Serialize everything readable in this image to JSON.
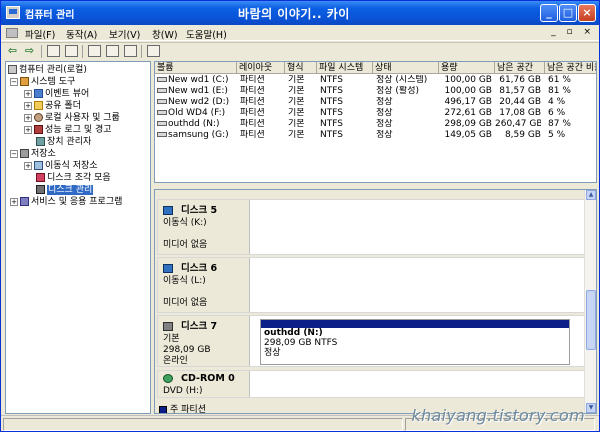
{
  "window": {
    "title": "컴퓨터 관리",
    "overlay_title": "바람의 이야기.. 카이",
    "controls": {
      "minimize": "_",
      "maximize": "□",
      "close": "×"
    }
  },
  "menu": {
    "items": [
      "파일(F)",
      "동작(A)",
      "보기(V)",
      "창(W)",
      "도움말(H)"
    ],
    "mdi_controls": "_ ▫ ×"
  },
  "toolbar": {
    "back": "⇦",
    "forward": "⇨"
  },
  "tree": {
    "root": "컴퓨터 관리(로컬)",
    "system_tools": "시스템 도구",
    "event_viewer": "이벤트 뷰어",
    "shared_folders": "공유 폴더",
    "local_users": "로컬 사용자 및 그룹",
    "perf_logs": "성능 로그 및 경고",
    "device_manager": "장치 관리자",
    "storage": "저장소",
    "removable_storage": "이동식 저장소",
    "defrag": "디스크 조각 모음",
    "disk_management": "디스크 관리",
    "services": "서비스 및 응용 프로그램"
  },
  "volumes": {
    "columns": [
      "볼륨",
      "레이아웃",
      "형식",
      "파일 시스템",
      "상태",
      "용량",
      "남은 공간",
      "남은 공간 비율"
    ],
    "rows": [
      [
        "New wd1 (C:)",
        "파티션",
        "기본",
        "NTFS",
        "정상 (시스템)",
        "100,00 GB",
        "61,76 GB",
        "61 %"
      ],
      [
        "New wd1 (E:)",
        "파티션",
        "기본",
        "NTFS",
        "정상 (활성)",
        "100,00 GB",
        "81,57 GB",
        "81 %"
      ],
      [
        "New wd2 (D:)",
        "파티션",
        "기본",
        "NTFS",
        "정상",
        "496,17 GB",
        "20,44 GB",
        "4 %"
      ],
      [
        "Old WD4 (F:)",
        "파티션",
        "기본",
        "NTFS",
        "정상",
        "272,61 GB",
        "17,08 GB",
        "6 %"
      ],
      [
        "outhdd (N:)",
        "파티션",
        "기본",
        "NTFS",
        "정상",
        "298,09 GB",
        "260,47 GB",
        "87 %"
      ],
      [
        "samsung (G:)",
        "파티션",
        "기본",
        "NTFS",
        "정상",
        "149,05 GB",
        "8,59 GB",
        "5 %"
      ]
    ]
  },
  "disks": [
    {
      "title": "디스크 5",
      "line1": "이동식 (K:)",
      "line2": "",
      "line3": "미디어 없음"
    },
    {
      "title": "디스크 6",
      "line1": "이동식 (L:)",
      "line2": "",
      "line3": "미디어 없음"
    },
    {
      "title": "디스크 7",
      "line1": "기본",
      "line2": "298,09 GB",
      "line3": "온라인",
      "partition": {
        "name": "outhdd  (N:)",
        "size": "298,09 GB NTFS",
        "status": "정상"
      }
    },
    {
      "title": "CD-ROM 0",
      "line1": "DVD (H:)",
      "line2": "",
      "line3": ""
    }
  ],
  "legend": {
    "primary_partition": "주 파티션"
  },
  "watermark": "khaiyang.tistory.com",
  "colors": {
    "titlebar": "#0a54d8",
    "partition_bar": "#0c1e88",
    "selection": "#316ac5"
  }
}
